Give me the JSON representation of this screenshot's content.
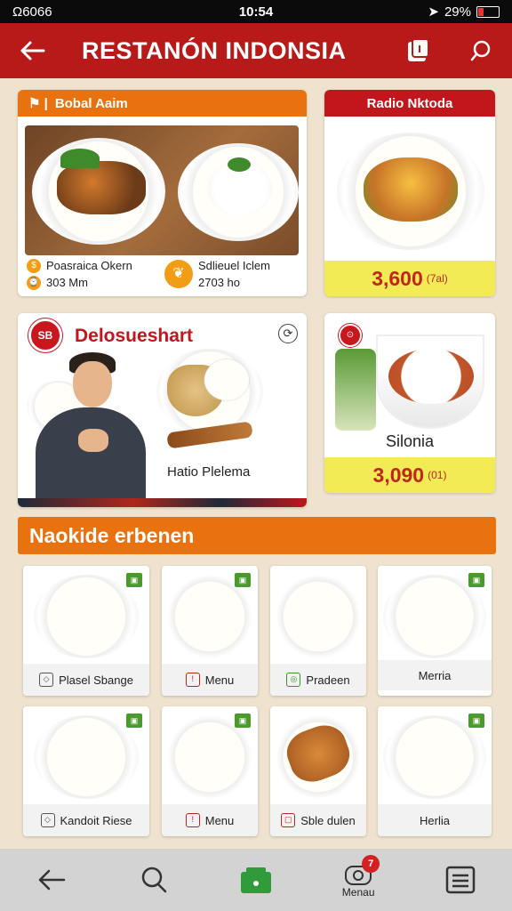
{
  "status_bar": {
    "carrier": "Ω6066",
    "time": "10:54",
    "battery": "29%"
  },
  "header": {
    "title": "RESTANÓN INDONSIA"
  },
  "featured": {
    "label": "Bobal Aaim",
    "info": [
      {
        "name": "Poasraica Okern",
        "detail": "303 Mm"
      },
      {
        "name": "Sdlieuel Iclem",
        "detail": "2703 ho"
      }
    ]
  },
  "card_right_1": {
    "label": "Radio Nktoda",
    "price": "3,600",
    "unit": "(7al)"
  },
  "promo": {
    "title": "Delosueshart",
    "logo_text": "SB",
    "caption": "Hatio Plelema"
  },
  "card_right_2": {
    "name": "Silonia",
    "price": "3,090",
    "unit": "(01)"
  },
  "section": {
    "title": "Naokide erbenen"
  },
  "menu_tiles": [
    {
      "label": "Plasel Sbange",
      "icon": "leaf-icon"
    },
    {
      "label": "Menu",
      "icon": "menu-icon"
    },
    {
      "label": "Pradeen",
      "icon": "dish-icon"
    },
    {
      "label": "Merria",
      "icon": "none"
    },
    {
      "label": "Kandoit Riese",
      "icon": "leaf-icon"
    },
    {
      "label": "Menu",
      "icon": "menu-icon"
    },
    {
      "label": "Sble dulen",
      "icon": "lock-icon"
    },
    {
      "label": "Herlia",
      "icon": "none"
    }
  ],
  "bottom_nav": {
    "cart_label": "Menau",
    "notification_count": "7"
  },
  "colors": {
    "header": "#b81a1a",
    "orange": "#e8720f",
    "price_band": "#f3eb55",
    "price_text": "#c0261c"
  }
}
